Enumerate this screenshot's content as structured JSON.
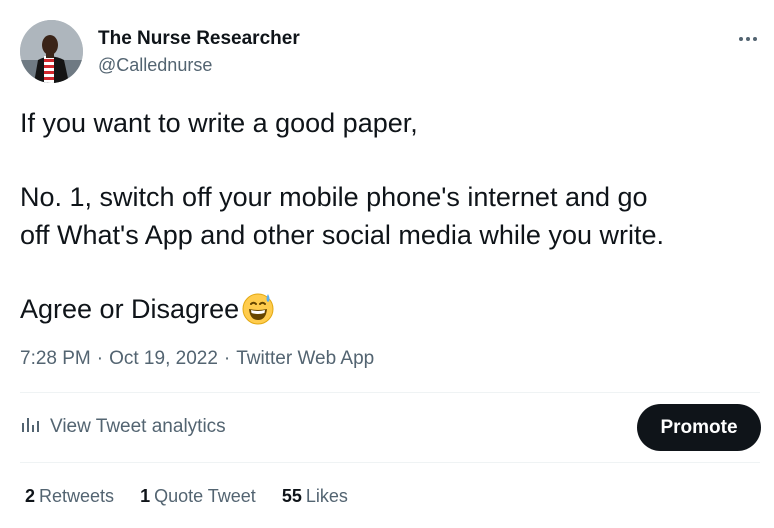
{
  "author": {
    "name": "The Nurse Researcher",
    "handle": "@Callednurse"
  },
  "tweet": {
    "line1": "If you want to write a good paper,",
    "line2": "No. 1, switch off your mobile phone's internet and go",
    "line3": "off What's App and other social media while you write.",
    "line4": "Agree or Disagree",
    "emoji": "grinning-face-with-sweat-icon"
  },
  "meta": {
    "time": "7:28 PM",
    "separator": "·",
    "date": "Oct 19, 2022",
    "source": "Twitter Web App"
  },
  "actions": {
    "analytics_label": "View Tweet analytics",
    "promote_label": "Promote"
  },
  "stats": {
    "retweets_count": "2",
    "retweets_label": "Retweets",
    "quotes_count": "1",
    "quotes_label": "Quote Tweet",
    "likes_count": "55",
    "likes_label": "Likes"
  },
  "colors": {
    "text": "#0f1419",
    "secondary": "#536471",
    "divider": "#eff3f4",
    "promote_bg": "#0f1419"
  }
}
